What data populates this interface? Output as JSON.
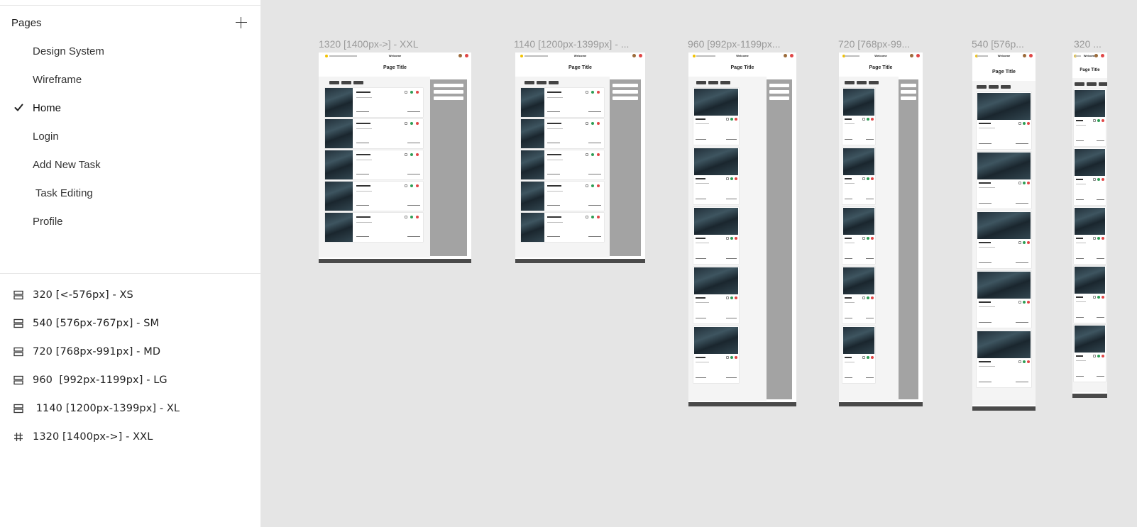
{
  "sidebar": {
    "pages_title": "Pages",
    "pages": [
      {
        "label": "Design System",
        "active": false
      },
      {
        "label": "Wireframe",
        "active": false
      },
      {
        "label": "Home",
        "active": true
      },
      {
        "label": "Login",
        "active": false
      },
      {
        "label": "Add New Task",
        "active": false
      },
      {
        "label": " Task Editing",
        "active": false
      },
      {
        "label": "Profile",
        "active": false
      }
    ],
    "layers": [
      {
        "label": "320 [<-576px] - XS",
        "icon": "section-icon"
      },
      {
        "label": "540 [576px-767px] - SM",
        "icon": "section-icon"
      },
      {
        "label": "720 [768px-991px] - MD",
        "icon": "section-icon"
      },
      {
        "label": "960  [992px-1199px] - LG",
        "icon": "section-icon"
      },
      {
        "label": " 1140 [1200px-1399px] - XL",
        "icon": "section-icon"
      },
      {
        "label": "1320 [1400px->] - XXL",
        "icon": "frame-grid-icon"
      }
    ]
  },
  "canvas": {
    "frames": [
      {
        "label": "1320 [1400px->] - XXL",
        "page_title": "Page Title",
        "welcome": "Welcome"
      },
      {
        "label": "1140 [1200px-1399px] - ...",
        "page_title": "Page Title",
        "welcome": "Welcome"
      },
      {
        "label": "960  [992px-1199px...",
        "page_title": "Page Title",
        "welcome": "Welcome"
      },
      {
        "label": "720 [768px-99...",
        "page_title": "Page Title",
        "welcome": "Welcome"
      },
      {
        "label": "540 [576p...",
        "page_title": "Page Title",
        "welcome": "Welcome"
      },
      {
        "label": "320 ...",
        "page_title": "Page Title",
        "welcome": "Welcome"
      }
    ]
  },
  "colors": {
    "canvas_bg": "#e5e5e5",
    "sidebar_bg": "#ffffff",
    "frame_label": "#9a9a9a",
    "sidebar_panel": "#a3a3a3",
    "delete_red": "#e04646",
    "done_green": "#2e9d55"
  }
}
